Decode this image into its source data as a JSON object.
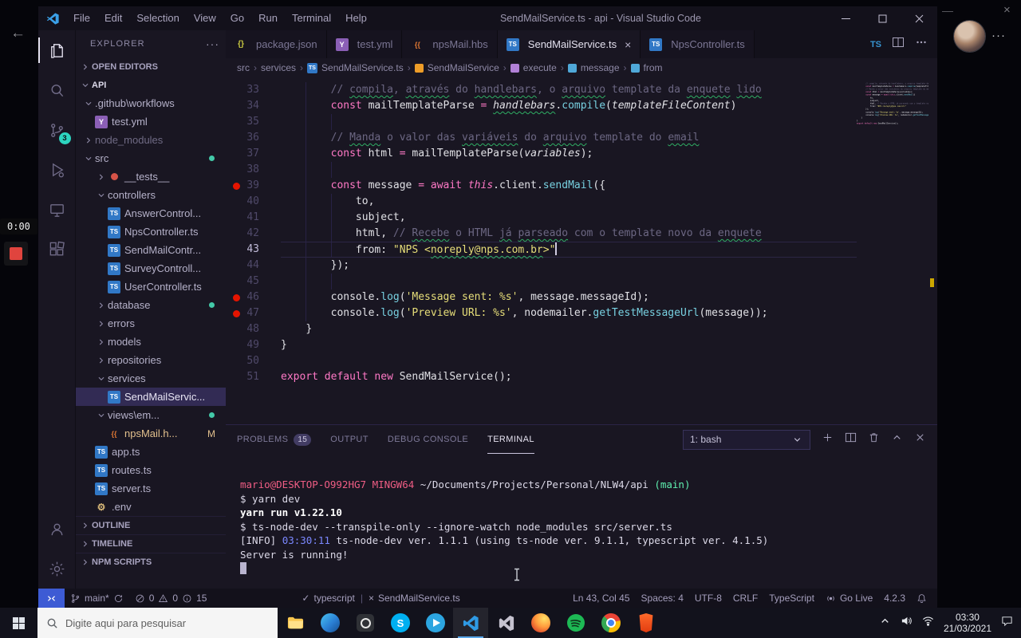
{
  "window": {
    "title": "SendMailService.ts - api - Visual Studio Code",
    "menu": [
      "File",
      "Edit",
      "Selection",
      "View",
      "Go",
      "Run",
      "Terminal",
      "Help"
    ]
  },
  "activity": {
    "scm_badge": "3"
  },
  "overlay": {
    "rec_timer": "0:00"
  },
  "sidebar": {
    "header": "EXPLORER",
    "open_editors": "OPEN EDITORS",
    "project": "API",
    "outline": "OUTLINE",
    "timeline": "TIMELINE",
    "npm_scripts": "NPM SCRIPTS",
    "tree": [
      {
        "label": ".github\\workflows",
        "lvl": 0,
        "chev": "down"
      },
      {
        "label": "test.yml",
        "lvl": 1,
        "icon": "yml"
      },
      {
        "label": "node_modules",
        "lvl": 0,
        "chev": "right",
        "dim": true
      },
      {
        "label": "src",
        "lvl": 0,
        "chev": "down",
        "dot": true
      },
      {
        "label": "__tests__",
        "lvl": 1,
        "chev": "right",
        "icon": "test"
      },
      {
        "label": "controllers",
        "lvl": 1,
        "chev": "down"
      },
      {
        "label": "AnswerControl...",
        "lvl": 2,
        "icon": "ts"
      },
      {
        "label": "NpsController.ts",
        "lvl": 2,
        "icon": "ts"
      },
      {
        "label": "SendMailContr...",
        "lvl": 2,
        "icon": "ts"
      },
      {
        "label": "SurveyControll...",
        "lvl": 2,
        "icon": "ts"
      },
      {
        "label": "UserController.ts",
        "lvl": 2,
        "icon": "ts"
      },
      {
        "label": "database",
        "lvl": 1,
        "chev": "right",
        "dot": true
      },
      {
        "label": "errors",
        "lvl": 1,
        "chev": "right"
      },
      {
        "label": "models",
        "lvl": 1,
        "chev": "right"
      },
      {
        "label": "repositories",
        "lvl": 1,
        "chev": "right"
      },
      {
        "label": "services",
        "lvl": 1,
        "chev": "down"
      },
      {
        "label": "SendMailServic...",
        "lvl": 2,
        "icon": "ts",
        "selected": true
      },
      {
        "label": "views\\em...",
        "lvl": 1,
        "chev": "down",
        "dot": true
      },
      {
        "label": "npsMail.h...",
        "lvl": 2,
        "icon": "hbs",
        "badge": "M",
        "modified": true
      },
      {
        "label": "app.ts",
        "lvl": 1,
        "icon": "ts"
      },
      {
        "label": "routes.ts",
        "lvl": 1,
        "icon": "ts"
      },
      {
        "label": "server.ts",
        "lvl": 1,
        "icon": "ts"
      },
      {
        "label": ".env",
        "lvl": 1,
        "icon": "env"
      }
    ]
  },
  "tabs": [
    {
      "label": "package.json",
      "icon": "json"
    },
    {
      "label": "test.yml",
      "icon": "yml"
    },
    {
      "label": "npsMail.hbs",
      "icon": "hbs"
    },
    {
      "label": "SendMailService.ts",
      "icon": "ts",
      "active": true
    },
    {
      "label": "NpsController.ts",
      "icon": "ts"
    }
  ],
  "breadcrumbs": [
    {
      "label": "src"
    },
    {
      "label": "services"
    },
    {
      "label": "SendMailService.ts",
      "icon": "ts"
    },
    {
      "label": "SendMailService",
      "icon": "class"
    },
    {
      "label": "execute",
      "icon": "method"
    },
    {
      "label": "message",
      "icon": "var"
    },
    {
      "label": "from",
      "icon": "var"
    }
  ],
  "editor": {
    "lines": [
      {
        "n": 33,
        "ind": 8,
        "g": [
          4
        ],
        "tk": [
          [
            "c",
            "// "
          ],
          [
            "cw",
            "compila"
          ],
          [
            "c",
            ", "
          ],
          [
            "cw",
            "através"
          ],
          [
            "c",
            " do "
          ],
          [
            "cw",
            "handlebars"
          ],
          [
            "c",
            ", o "
          ],
          [
            "cw",
            "arquivo"
          ],
          [
            "c",
            " template da "
          ],
          [
            "cw",
            "enquete"
          ],
          [
            "c",
            " "
          ],
          [
            "cw",
            "lido"
          ]
        ]
      },
      {
        "n": 34,
        "ind": 8,
        "g": [
          4
        ],
        "tk": [
          [
            "k",
            "const"
          ],
          [
            "t",
            " mailTemplateParse "
          ],
          [
            "o",
            "="
          ],
          [
            "t",
            " "
          ],
          [
            "iw",
            "handlebars"
          ],
          [
            "t",
            "."
          ],
          [
            "f",
            "compile"
          ],
          [
            "t",
            "("
          ],
          [
            "pa",
            "templateFileContent"
          ],
          [
            "t",
            ")"
          ]
        ]
      },
      {
        "n": 35,
        "ind": 0,
        "g": [
          4,
          8
        ],
        "tk": []
      },
      {
        "n": 36,
        "ind": 8,
        "g": [
          4
        ],
        "tk": [
          [
            "c",
            "// "
          ],
          [
            "cw",
            "Manda"
          ],
          [
            "c",
            " o valor das "
          ],
          [
            "cw",
            "variáveis"
          ],
          [
            "c",
            " do "
          ],
          [
            "cw",
            "arquivo"
          ],
          [
            "c",
            " template do "
          ],
          [
            "cw",
            "email"
          ]
        ]
      },
      {
        "n": 37,
        "ind": 8,
        "g": [
          4
        ],
        "tk": [
          [
            "k",
            "const"
          ],
          [
            "t",
            " html "
          ],
          [
            "o",
            "="
          ],
          [
            "t",
            " mailTemplateParse("
          ],
          [
            "pa",
            "variables"
          ],
          [
            "t",
            ");"
          ]
        ]
      },
      {
        "n": 38,
        "ind": 0,
        "g": [
          4,
          8
        ],
        "tk": []
      },
      {
        "n": 39,
        "ind": 8,
        "g": [
          4
        ],
        "bp": true,
        "tk": [
          [
            "k",
            "const"
          ],
          [
            "t",
            " message "
          ],
          [
            "o",
            "="
          ],
          [
            "t",
            " "
          ],
          [
            "k",
            "await"
          ],
          [
            "t",
            " "
          ],
          [
            "ki",
            "this"
          ],
          [
            "t",
            ".client."
          ],
          [
            "f",
            "sendMail"
          ],
          [
            "t",
            "({"
          ]
        ]
      },
      {
        "n": 40,
        "ind": 12,
        "g": [
          4,
          8
        ],
        "tk": [
          [
            "t",
            "to,"
          ]
        ]
      },
      {
        "n": 41,
        "ind": 12,
        "g": [
          4,
          8
        ],
        "tk": [
          [
            "t",
            "subject,"
          ]
        ]
      },
      {
        "n": 42,
        "ind": 12,
        "g": [
          4,
          8
        ],
        "tk": [
          [
            "t",
            "html, "
          ],
          [
            "c",
            "// "
          ],
          [
            "cw",
            "Recebe"
          ],
          [
            "c",
            " o HTML "
          ],
          [
            "cw",
            "já"
          ],
          [
            "c",
            " "
          ],
          [
            "cw",
            "parseado"
          ],
          [
            "c",
            " com o template novo da "
          ],
          [
            "cw",
            "enquete"
          ]
        ]
      },
      {
        "n": 43,
        "ind": 12,
        "g": [
          4,
          8
        ],
        "cur": true,
        "cursor": true,
        "tk": [
          [
            "t",
            "from: "
          ],
          [
            "s",
            "\"NPS <"
          ],
          [
            "sw",
            "noreply@nps.com.br"
          ],
          [
            "s",
            ">\""
          ]
        ]
      },
      {
        "n": 44,
        "ind": 8,
        "g": [
          4
        ],
        "tk": [
          [
            "t",
            "});"
          ]
        ]
      },
      {
        "n": 45,
        "ind": 0,
        "g": [
          4,
          8
        ],
        "tk": []
      },
      {
        "n": 46,
        "ind": 8,
        "g": [
          4
        ],
        "bp": true,
        "tk": [
          [
            "t",
            "console."
          ],
          [
            "f",
            "log"
          ],
          [
            "t",
            "("
          ],
          [
            "s",
            "'Message sent: %s'"
          ],
          [
            "t",
            ", message.messageId);"
          ]
        ]
      },
      {
        "n": 47,
        "ind": 8,
        "g": [
          4
        ],
        "bp": true,
        "tk": [
          [
            "t",
            "console."
          ],
          [
            "f",
            "log"
          ],
          [
            "t",
            "("
          ],
          [
            "s",
            "'Preview URL: %s'"
          ],
          [
            "t",
            ", nodemailer."
          ],
          [
            "f",
            "getTestMessageUrl"
          ],
          [
            "t",
            "(message));"
          ]
        ]
      },
      {
        "n": 48,
        "ind": 4,
        "g": [],
        "tk": [
          [
            "t",
            "}"
          ]
        ]
      },
      {
        "n": 49,
        "ind": 0,
        "g": [],
        "tk": [
          [
            "t",
            "}"
          ]
        ]
      },
      {
        "n": 50,
        "ind": 0,
        "g": [],
        "tk": []
      },
      {
        "n": 51,
        "ind": 0,
        "g": [],
        "tk": [
          [
            "k",
            "export"
          ],
          [
            "t",
            " "
          ],
          [
            "k",
            "default"
          ],
          [
            "t",
            " "
          ],
          [
            "k",
            "new"
          ],
          [
            "t",
            " SendMailService();"
          ]
        ]
      }
    ]
  },
  "panel": {
    "tabs": [
      {
        "label": "PROBLEMS",
        "badge": "15"
      },
      {
        "label": "OUTPUT"
      },
      {
        "label": "DEBUG CONSOLE"
      },
      {
        "label": "TERMINAL",
        "active": true
      }
    ],
    "shell": "1: bash",
    "terminal": [
      {
        "tk": [
          [
            "m",
            "mario@DESKTOP-O992HG7"
          ],
          [
            "t",
            " "
          ],
          [
            "m",
            "MINGW64"
          ],
          [
            "t",
            " "
          ],
          [
            "t",
            "~/Documents/Projects/Personal/NLW4/api"
          ],
          [
            "t",
            " "
          ],
          [
            "b",
            "(main)"
          ]
        ]
      },
      {
        "tk": [
          [
            "t",
            "$ yarn dev"
          ]
        ]
      },
      {
        "tk": [
          [
            "bold",
            "yarn run v1.22.10"
          ]
        ]
      },
      {
        "tk": [
          [
            "t",
            "$ ts-node-dev --transpile-only --ignore-watch node_modules src/server.ts"
          ]
        ]
      },
      {
        "tk": [
          [
            "t",
            "[INFO] "
          ],
          [
            "blue",
            "03:30:11"
          ],
          [
            "t",
            " ts-node-dev ver. 1.1.1 (using ts-node ver. 9.1.1, typescript ver. 4.1.5)"
          ]
        ]
      },
      {
        "tk": [
          [
            "t",
            "Server is running!"
          ]
        ]
      },
      {
        "tk": [
          [
            "cursor",
            ""
          ]
        ]
      }
    ]
  },
  "status": {
    "branch": "main*",
    "errors": "0",
    "warnings": "0",
    "infos": "15",
    "check_glyph": "✓",
    "cross_glyph": "×",
    "ts_label": "typescript",
    "file_label": "SendMailService.ts",
    "ln_col": "Ln 43, Col 45",
    "spaces": "Spaces: 4",
    "encoding": "UTF-8",
    "eol": "CRLF",
    "lang": "TypeScript",
    "golive": "Go Live",
    "version": "4.2.3"
  },
  "taskbar": {
    "search_placeholder": "Digite aqui para pesquisar",
    "clock_time": "03:30",
    "clock_date": "21/03/2021"
  }
}
